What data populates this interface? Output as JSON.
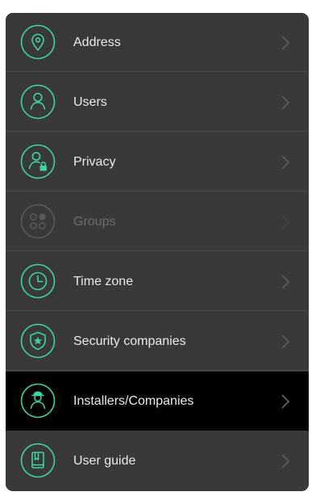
{
  "colors": {
    "accent": "#3dd3a6",
    "accent_disabled": "#595959",
    "panel_bg": "#393939",
    "active_bg": "#000000",
    "text": "#eaeaea",
    "text_disabled": "#6b6b6b",
    "chevron": "#5e5e5e"
  },
  "menu": {
    "items": [
      {
        "label": "Address",
        "icon": "location-pin-icon",
        "state": "normal"
      },
      {
        "label": "Users",
        "icon": "user-icon",
        "state": "normal"
      },
      {
        "label": "Privacy",
        "icon": "user-lock-icon",
        "state": "normal"
      },
      {
        "label": "Groups",
        "icon": "groups-icon",
        "state": "disabled"
      },
      {
        "label": "Time zone",
        "icon": "clock-icon",
        "state": "normal"
      },
      {
        "label": "Security companies",
        "icon": "shield-star-icon",
        "state": "normal"
      },
      {
        "label": "Installers/Companies",
        "icon": "installer-icon",
        "state": "active"
      },
      {
        "label": "User guide",
        "icon": "book-icon",
        "state": "normal"
      }
    ]
  }
}
